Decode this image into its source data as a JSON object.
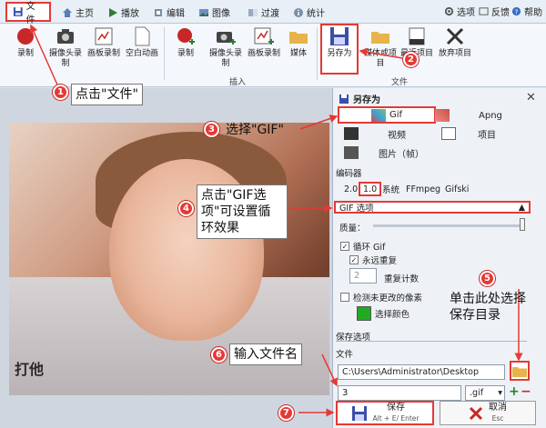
{
  "tabbar": {
    "tabs": [
      {
        "label": "文件",
        "icon": "save-icon"
      },
      {
        "label": "主页",
        "icon": "home-icon"
      },
      {
        "label": "播放",
        "icon": "play-icon"
      },
      {
        "label": "编辑",
        "icon": "edit-icon"
      },
      {
        "label": "图像",
        "icon": "image-icon"
      },
      {
        "label": "过渡",
        "icon": "transition-icon"
      },
      {
        "label": "统计",
        "icon": "stats-icon"
      }
    ],
    "right": [
      {
        "label": "选项",
        "icon": "options-icon"
      },
      {
        "label": "反馈",
        "icon": "feedback-icon"
      },
      {
        "label": "帮助",
        "icon": "help-icon"
      }
    ]
  },
  "ribbon": {
    "groups": [
      {
        "label": "插入",
        "buttons": [
          "录制",
          "摄像头录制",
          "画板录制",
          "空白动画",
          "录制",
          "摄像头录制",
          "画板录制",
          "媒体"
        ]
      },
      {
        "label": "文件",
        "buttons": [
          "另存为",
          "媒体或项目",
          "最近项目",
          "放弃项目"
        ]
      }
    ]
  },
  "photo": {
    "caption": "打他"
  },
  "panel": {
    "title": "另存为",
    "formats": {
      "gif": "Gif",
      "apng": "Apng",
      "video": "视频",
      "project": "项目",
      "images": "图片（帧）"
    },
    "encoder_label": "编码器",
    "encoders": [
      "2.0",
      "1.0",
      "系统",
      "FFmpeg",
      "Gifski"
    ],
    "gif_options_label": "GIF 选项",
    "quality_label": "质量：",
    "loop_label": "循环 Gif",
    "repeat_forever_label": "永远重复",
    "repeat_count_value": "2",
    "repeat_count_label": "重复计数",
    "detect_unchanged_label": "检测未更改的像素",
    "choose_color_label": "选择颜色",
    "choose_color": "#22aa22",
    "save_options_label": "保存选项",
    "file_label": "文件",
    "path_value": "C:\\Users\\Administrator\\Desktop",
    "filename_value": "3",
    "extension_value": ".gif",
    "save_label": "保存",
    "save_shortcut": "Alt + E/ Enter",
    "cancel_label": "取消",
    "cancel_shortcut": "Esc"
  },
  "annotations": {
    "s1": {
      "num": "1",
      "text": "点击\"文件\""
    },
    "s2": {
      "num": "2"
    },
    "s3": {
      "num": "3",
      "text": "选择\"GIF\""
    },
    "s4": {
      "num": "4",
      "text": "点击\"GIF选项\"可设置循环效果"
    },
    "s5": {
      "num": "5",
      "text": "单击此处选择保存目录"
    },
    "s6": {
      "num": "6",
      "text": "输入文件名"
    },
    "s7": {
      "num": "7"
    }
  },
  "colors": {
    "accent_red": "#e53935",
    "ribbon_bg": "#f4f7fb",
    "panel_bg": "#eef2f7"
  }
}
